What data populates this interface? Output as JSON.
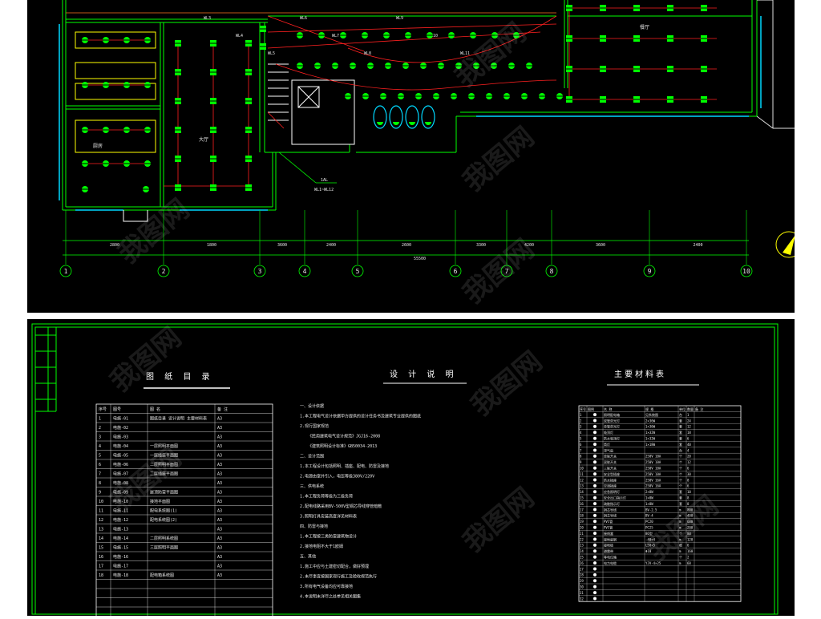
{
  "plan": {
    "axis_labels": [
      "1",
      "2",
      "3",
      "4",
      "5",
      "6",
      "7",
      "8",
      "9",
      "10"
    ],
    "total_dimension": "55500",
    "segment_dims": [
      "2800",
      "1800",
      "3600",
      "2400",
      "2600",
      "3300",
      "4200",
      "3600",
      "2400"
    ],
    "room_labels": [
      "厨房",
      "大厅",
      "餐厅"
    ],
    "callout_lines": [
      "1AL",
      "WL1~WL12"
    ],
    "wire_tags": [
      "WL3",
      "WL4",
      "WL5",
      "WL6",
      "WL7",
      "WL8",
      "WL9",
      "WL10",
      "WL11"
    ]
  },
  "sheet": {
    "index_title": "图 纸 目 录",
    "notes_title": "设 计 说 明",
    "materials_title": "主要材料表",
    "index_header": [
      "序号",
      "图号",
      "图 名",
      "备 注"
    ],
    "index_rows": [
      [
        "1",
        "电施-01",
        "图纸目录 设计说明 主要材料表",
        "A3"
      ],
      [
        "2",
        "电施-02",
        "",
        "A3"
      ],
      [
        "3",
        "电施-03",
        "",
        "A3"
      ],
      [
        "4",
        "电施-04",
        "一层照明平面图",
        "A3"
      ],
      [
        "5",
        "电施-05",
        "一层插座平面图",
        "A3"
      ],
      [
        "6",
        "电施-06",
        "二层照明平面图",
        "A3"
      ],
      [
        "7",
        "电施-07",
        "二层插座平面图",
        "A3"
      ],
      [
        "8",
        "电施-08",
        "",
        "A3"
      ],
      [
        "9",
        "电施-09",
        "屋顶防雷平面图",
        "A3"
      ],
      [
        "10",
        "电施-10",
        "接地平面图",
        "A3"
      ],
      [
        "11",
        "电施-11",
        "配电系统图(1)",
        "A3"
      ],
      [
        "12",
        "电施-12",
        "配电系统图(2)",
        "A3"
      ],
      [
        "13",
        "电施-13",
        "",
        "A3"
      ],
      [
        "14",
        "电施-14",
        "二层照明系统图",
        "A3"
      ],
      [
        "15",
        "电施-15",
        "三层照明平面图",
        "A3"
      ],
      [
        "16",
        "电施-16",
        "",
        "A3"
      ],
      [
        "17",
        "电施-17",
        "",
        "A3"
      ],
      [
        "18",
        "电施-18",
        "配电箱系统图",
        "A3"
      ]
    ],
    "notes_lines": [
      "一、设计依据",
      "1.本工程电气设计依据甲方提供的设计任务书及建筑专业提供的图纸",
      "2.现行国家规范",
      "《民用建筑电气设计规范》JGJ16-2008",
      "《建筑照明设计标准》GB50034-2013",
      "二、设计范围",
      "1.本工程设计包括照明、插座、配电、防雷及接地",
      "2.电源由室外引入，电压等级380V/220V",
      "三、供电系统",
      "1.本工程负荷等级为三级负荷",
      "2.配电线路采用BV-500V型铜芯导线穿管暗敷",
      "3.照明灯具安装高度详见材料表",
      "四、防雷与接地",
      "1.本工程按三类防雷建筑物设计",
      "2.接地电阻不大于1欧姆",
      "五、其他",
      "1.施工中应与土建密切配合，做好预埋",
      "2.未尽事宜按国家现行施工及验收规范执行",
      "3.所有电气设备均应可靠接地",
      "4.本说明未详尽之处参见相关图集"
    ],
    "materials_header": [
      "序号",
      "图例",
      "名 称",
      "规 格",
      "单位",
      "数量",
      "备 注"
    ],
    "materials_rows": [
      [
        "1",
        "",
        "照明配电箱",
        "见系统图",
        "台",
        "1",
        ""
      ],
      [
        "2",
        "",
        "双管荧光灯",
        "2×36W",
        "套",
        "24",
        ""
      ],
      [
        "3",
        "",
        "单管荧光灯",
        "1×36W",
        "套",
        "12",
        ""
      ],
      [
        "4",
        "",
        "吸顶灯",
        "1×32W",
        "套",
        "18",
        ""
      ],
      [
        "5",
        "",
        "防水吸顶灯",
        "1×32W",
        "套",
        "6",
        ""
      ],
      [
        "6",
        "",
        "筒灯",
        "1×18W",
        "套",
        "40",
        ""
      ],
      [
        "7",
        "",
        "排气扇",
        "",
        "台",
        "4",
        ""
      ],
      [
        "8",
        "",
        "单联开关",
        "250V 10A",
        "个",
        "20",
        ""
      ],
      [
        "9",
        "",
        "双联开关",
        "250V 10A",
        "个",
        "12",
        ""
      ],
      [
        "10",
        "",
        "三联开关",
        "250V 10A",
        "个",
        "6",
        ""
      ],
      [
        "11",
        "",
        "安全型插座",
        "250V 10A",
        "个",
        "30",
        ""
      ],
      [
        "12",
        "",
        "防水插座",
        "250V 16A",
        "个",
        "8",
        ""
      ],
      [
        "13",
        "",
        "空调插座",
        "250V 16A",
        "个",
        "6",
        ""
      ],
      [
        "14",
        "",
        "应急照明灯",
        "2×8W",
        "套",
        "10",
        ""
      ],
      [
        "15",
        "",
        "安全出口指示灯",
        "1×8W",
        "套",
        "8",
        ""
      ],
      [
        "16",
        "",
        "疏散指示灯",
        "1×8W",
        "套",
        "8",
        ""
      ],
      [
        "17",
        "",
        "铜芯导线",
        "BV-2.5",
        "m",
        "800",
        ""
      ],
      [
        "18",
        "",
        "铜芯导线",
        "BV-4",
        "m",
        "400",
        ""
      ],
      [
        "19",
        "",
        "PVC管",
        "PC20",
        "m",
        "600",
        ""
      ],
      [
        "20",
        "",
        "PVC管",
        "PC25",
        "m",
        "200",
        ""
      ],
      [
        "21",
        "",
        "接线盒",
        "86型",
        "个",
        "80",
        ""
      ],
      [
        "22",
        "",
        "接地扁钢",
        "-40×4",
        "m",
        "120",
        ""
      ],
      [
        "23",
        "",
        "接地极",
        "L50×5",
        "根",
        "6",
        ""
      ],
      [
        "24",
        "",
        "避雷带",
        "Φ10",
        "m",
        "160",
        ""
      ],
      [
        "25",
        "",
        "等电位箱",
        "",
        "个",
        "2",
        ""
      ],
      [
        "26",
        "",
        "电力电缆",
        "YJV-4×25",
        "m",
        "60",
        ""
      ],
      [
        "27",
        "",
        "",
        "",
        " ",
        "",
        ""
      ],
      [
        "28",
        "",
        "",
        "",
        " ",
        "",
        ""
      ],
      [
        "29",
        "",
        "",
        "",
        " ",
        "",
        ""
      ],
      [
        "30",
        "",
        "",
        "",
        " ",
        "",
        ""
      ],
      [
        "31",
        "",
        "",
        "",
        " ",
        "",
        ""
      ],
      [
        "32",
        "",
        "",
        "",
        " ",
        "",
        ""
      ]
    ]
  },
  "watermark": {
    "text": "我图网"
  }
}
